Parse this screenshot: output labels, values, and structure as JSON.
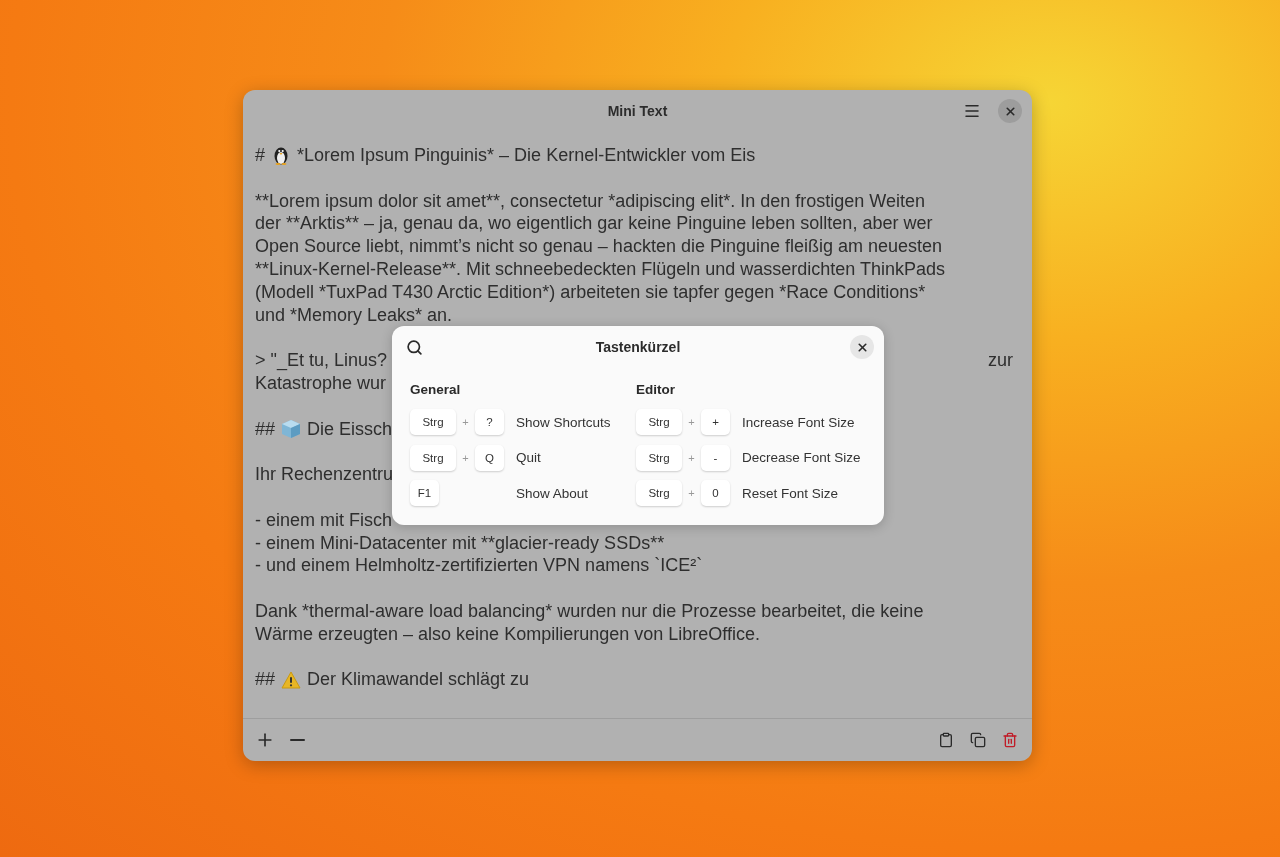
{
  "window": {
    "title": "Mini Text"
  },
  "editor": {
    "blocks": [
      {
        "kind": "heading",
        "prefix": "#",
        "lines": [
          {
            "text": "*Lorem Ipsum Pinguinis* – Die Kernel-Entwickler vom Eis"
          }
        ]
      },
      {
        "kind": "paragraph",
        "lines": [
          {
            "text": "**Lorem ipsum dolor sit amet**, consectetur *adipiscing elit*. In den frostigen Weiten"
          },
          {
            "text": "der **Arktis** – ja, genau da, wo eigentlich gar keine Pinguine leben sollten, aber wer"
          },
          {
            "text": "Open Source liebt, nimmt’s nicht so genau – hackten die Pinguine fleißig am neuesten"
          },
          {
            "text": "**Linux-Kernel-Release**. Mit schneebedeckten Flügeln und wasserdichten ThinkPads"
          },
          {
            "text": "(Modell *TuxPad T430 Arctic Edition*) arbeiteten sie tapfer gegen *Race Conditions*"
          },
          {
            "text": "und *Memory Leaks* an."
          }
        ]
      },
      {
        "kind": "paragraph",
        "lines": [
          {
            "text": "> \"_Et tu, Linus?",
            "tail": "zur"
          },
          {
            "text": "Katastrophe wur"
          }
        ]
      },
      {
        "kind": "heading",
        "prefix": "##",
        "lines": [
          {
            "text": "Die Eissch"
          }
        ]
      },
      {
        "kind": "paragraph",
        "lines": [
          {
            "text": "Ihr Rechenzentru"
          }
        ]
      },
      {
        "kind": "paragraph",
        "lines": [
          {
            "text": "- einem mit Fisch"
          },
          {
            "text": "- einem Mini-Datacenter mit **glacier-ready SSDs**"
          },
          {
            "text": "- und einem Helmholtz-zertifizierten VPN namens `ICE²`"
          }
        ]
      },
      {
        "kind": "paragraph",
        "lines": [
          {
            "text": "Dank *thermal-aware load balancing* wurden nur die Prozesse bearbeitet, die keine"
          },
          {
            "text": "Wärme erzeugten – also keine Kompilierungen von LibreOffice."
          }
        ]
      },
      {
        "kind": "heading",
        "prefix": "##",
        "lines": [
          {
            "text": "Der Klimawandel schlägt zu"
          }
        ]
      }
    ]
  },
  "dialog": {
    "title": "Tastenkürzel",
    "sections": [
      {
        "title": "General",
        "shortcuts": [
          {
            "keys": [
              "Strg",
              "?"
            ],
            "joiner": "+",
            "label": "Show Shortcuts"
          },
          {
            "keys": [
              "Strg",
              "Q"
            ],
            "joiner": "+",
            "label": "Quit"
          },
          {
            "keys": [
              "F1"
            ],
            "label": "Show About"
          }
        ]
      },
      {
        "title": "Editor",
        "shortcuts": [
          {
            "keys": [
              "Strg",
              "+"
            ],
            "joiner": "+",
            "label": "Increase Font Size"
          },
          {
            "keys": [
              "Strg",
              "-"
            ],
            "joiner": "+",
            "label": "Decrease Font Size"
          },
          {
            "keys": [
              "Strg",
              "0"
            ],
            "joiner": "+",
            "label": "Reset Font Size"
          }
        ]
      }
    ]
  }
}
